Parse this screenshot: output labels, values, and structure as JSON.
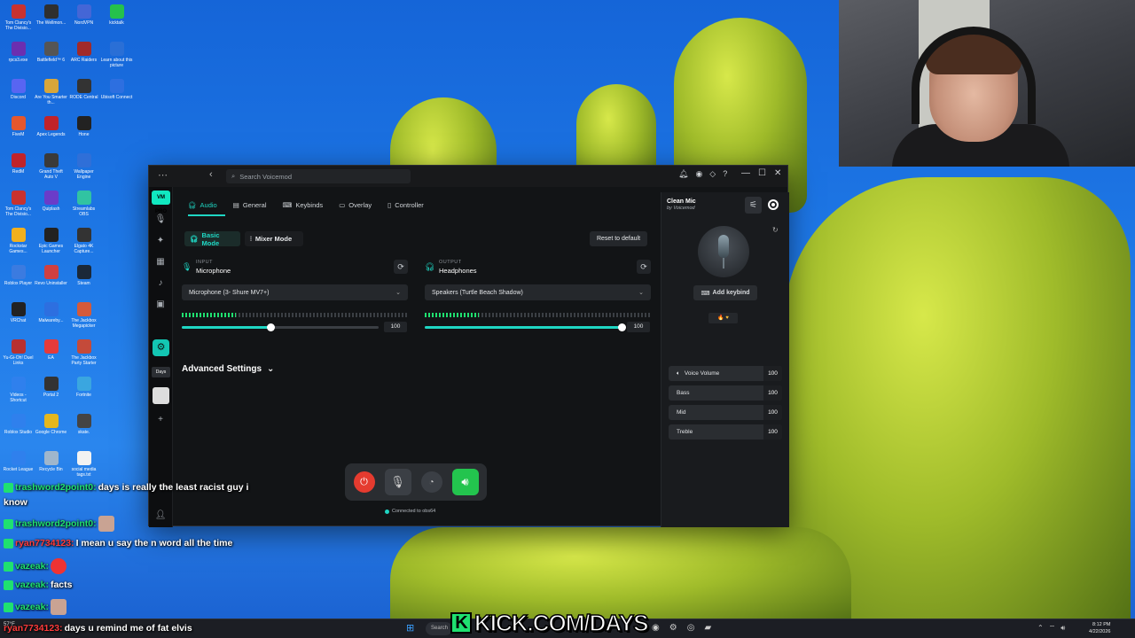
{
  "desktop": {
    "icons": [
      {
        "label": "Tom Clancy's The Divisio...",
        "color": "#c8322f"
      },
      {
        "label": "The Wellmon...",
        "color": "#2f2f2f"
      },
      {
        "label": "NordVPN",
        "color": "#4466d6"
      },
      {
        "label": "kicktalk",
        "color": "#25c14b"
      },
      {
        "label": "rpcs3.exe",
        "color": "#6b2fb0"
      },
      {
        "label": "Battlefield™ 6",
        "color": "#555555"
      },
      {
        "label": "ARC Raiders",
        "color": "#a12a2a"
      },
      {
        "label": "Learn about this picture",
        "color": "#2a6fd6"
      },
      {
        "label": "Discord",
        "color": "#5865f2"
      },
      {
        "label": "Are You Smarter th...",
        "color": "#d8a63a"
      },
      {
        "label": "RODE Central",
        "color": "#333333"
      },
      {
        "label": "Ubisoft Connect",
        "color": "#2d6fe0"
      },
      {
        "label": "FiveM",
        "color": "#e4572e"
      },
      {
        "label": "Apex Legends",
        "color": "#c0232a"
      },
      {
        "label": "Hone",
        "color": "#222222"
      },
      {
        "label": "",
        "color": "transparent"
      },
      {
        "label": "RedM",
        "color": "#c0232a"
      },
      {
        "label": "Grand Theft Auto V",
        "color": "#3a3a3a"
      },
      {
        "label": "Wallpaper Engine",
        "color": "#2f6fd8"
      },
      {
        "label": "",
        "color": "transparent"
      },
      {
        "label": "Tom Clancy's The Divisio...",
        "color": "#c8322f"
      },
      {
        "label": "Quiplash",
        "color": "#6a3cc9"
      },
      {
        "label": "Streamlabs OBS",
        "color": "#31c3a2"
      },
      {
        "label": "",
        "color": "transparent"
      },
      {
        "label": "Rockstar Games...",
        "color": "#f2b01e"
      },
      {
        "label": "Epic Games Launcher",
        "color": "#222222"
      },
      {
        "label": "Elgato 4K Capture...",
        "color": "#333333"
      },
      {
        "label": "",
        "color": "transparent"
      },
      {
        "label": "Roblox Player",
        "color": "#3b7be0"
      },
      {
        "label": "Revo Uninstaller",
        "color": "#d04040"
      },
      {
        "label": "Steam",
        "color": "#1b2838"
      },
      {
        "label": "",
        "color": "transparent"
      },
      {
        "label": "VRChat",
        "color": "#222222"
      },
      {
        "label": "Malwareby...",
        "color": "#2d6fe0"
      },
      {
        "label": "The Jackbox Megapicker",
        "color": "#d45a3a"
      },
      {
        "label": "",
        "color": "transparent"
      },
      {
        "label": "Yu-Gi-Oh! Duel Links",
        "color": "#b83030"
      },
      {
        "label": "EA",
        "color": "#e43b3b"
      },
      {
        "label": "The Jackbox Party Starter",
        "color": "#c44a3a"
      },
      {
        "label": "",
        "color": "transparent"
      },
      {
        "label": "Videos - Shortcut",
        "color": "#2f80ed"
      },
      {
        "label": "Portal 2",
        "color": "#333333"
      },
      {
        "label": "Fortnite",
        "color": "#3aa6e0"
      },
      {
        "label": "",
        "color": "transparent"
      },
      {
        "label": "Roblox Studio",
        "color": "#2f80ed"
      },
      {
        "label": "Google Chrome",
        "color": "#e4b71e"
      },
      {
        "label": "skate.",
        "color": "#444444"
      },
      {
        "label": "",
        "color": "transparent"
      },
      {
        "label": "Rocket League",
        "color": "#2f80ed"
      },
      {
        "label": "Recycle Bin",
        "color": "#9fb6cc"
      },
      {
        "label": "social media tags.txt",
        "color": "#f2f2f2"
      }
    ]
  },
  "voicemod": {
    "search_placeholder": "Search Voicemod",
    "title_icons": [
      "bell-icon",
      "discord-icon",
      "diamond-icon",
      "help-icon"
    ],
    "window_controls": [
      "—",
      "☐",
      "✕"
    ],
    "rail_logo": "VM PRO",
    "rail_days": "Days",
    "tabs": [
      {
        "label": "Audio",
        "icon": "headphones-icon",
        "name": "tab-audio"
      },
      {
        "label": "General",
        "icon": "sliders-icon",
        "name": "tab-general"
      },
      {
        "label": "Keybinds",
        "icon": "keybind-icon",
        "name": "tab-keybinds"
      },
      {
        "label": "Overlay",
        "icon": "overlay-icon",
        "name": "tab-overlay"
      },
      {
        "label": "Controller",
        "icon": "controller-icon",
        "name": "tab-controller"
      }
    ],
    "modes": {
      "basic": "Basic Mode",
      "mixer": "Mixer Mode"
    },
    "reset_label": "Reset to default",
    "input": {
      "label": "INPUT",
      "title": "Microphone",
      "device": "Microphone (3- Shure MV7+)",
      "meter_level": 0.24,
      "volume": 0.45,
      "volume_value": "100"
    },
    "output": {
      "label": "OUTPUT",
      "title": "Headphones",
      "device": "Speakers (Turtle Beach Shadow)",
      "meter_level": 0.24,
      "volume": 1.0,
      "volume_value": "100"
    },
    "advanced_label": "Advanced Settings",
    "connected_label": "Connected to obs64",
    "voice_panel": {
      "title": "Clean Mic",
      "subtitle": "by Voicemod",
      "add_keybind": "Add keybind",
      "likes": "🔥 ♥",
      "rows": [
        {
          "label": "Voice Volume",
          "value": "100",
          "icon": "speaker-icon"
        },
        {
          "label": "Bass",
          "value": "100",
          "icon": ""
        },
        {
          "label": "Mid",
          "value": "100",
          "icon": ""
        },
        {
          "label": "Treble",
          "value": "100",
          "icon": ""
        }
      ]
    }
  },
  "chat": [
    {
      "user": "trashword2point0:",
      "message": "days is really the least racist guy i",
      "user_color": "green"
    },
    {
      "user": "",
      "message": "know",
      "user_color": "green"
    },
    {
      "user": "trashword2point0:",
      "message": "",
      "user_color": "green"
    },
    {
      "user": "ryan7734123:",
      "message": "I mean u say the n word all the time",
      "user_color": "red"
    },
    {
      "user": "vazeak:",
      "message": "",
      "user_color": "green"
    },
    {
      "user": "vazeak:",
      "message": "facts",
      "user_color": "green"
    },
    {
      "user": "vazeak:",
      "message": "",
      "user_color": "green"
    },
    {
      "user": "ryan7734123:",
      "message": "days u remind me of fat elvis",
      "user_color": "red"
    }
  ],
  "banner": {
    "text": "KICK.COM/DAYS",
    "logo": "K"
  },
  "taskbar": {
    "search": "Search",
    "weather": "57°F",
    "clock_time": "8:12 PM",
    "clock_date": "4/22/2026"
  }
}
